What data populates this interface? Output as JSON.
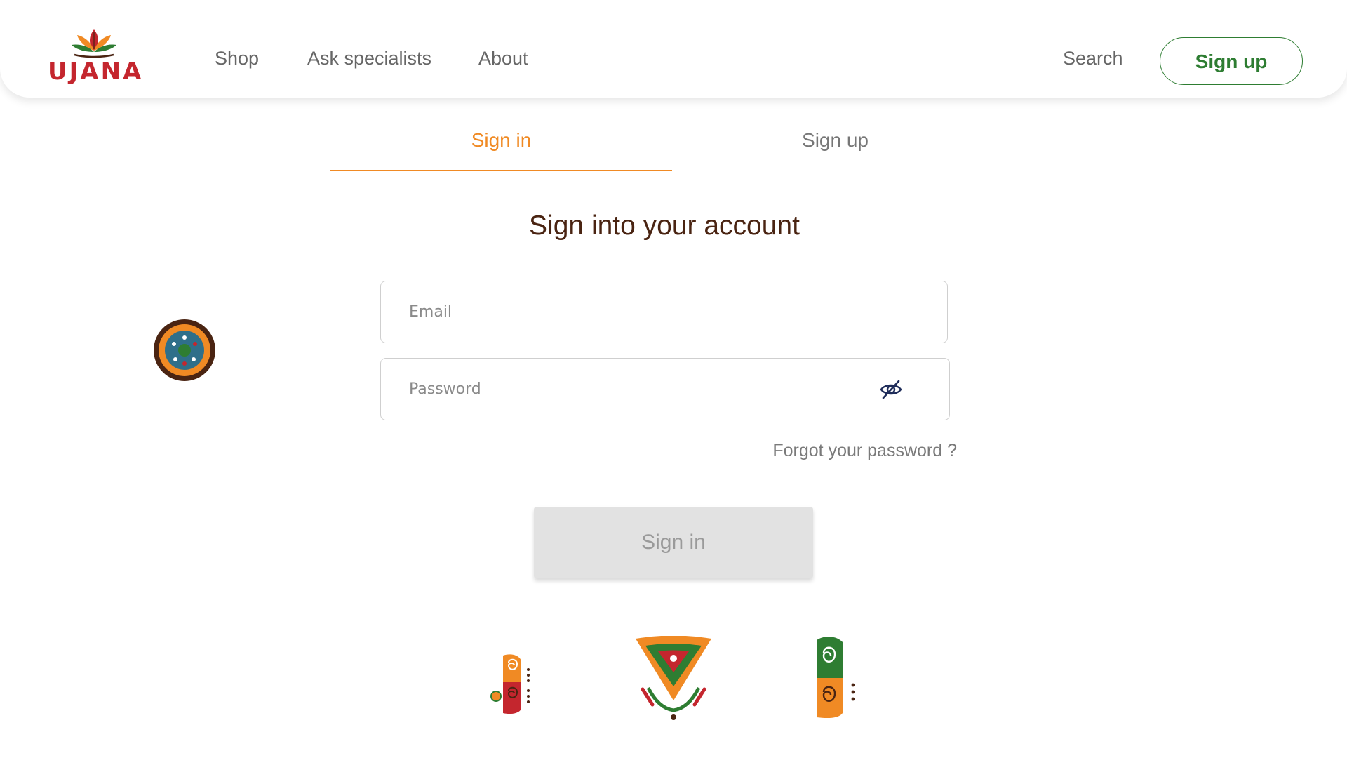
{
  "header": {
    "logo_text": "UJANA",
    "nav": {
      "shop": "Shop",
      "ask_specialists": "Ask specialists",
      "about": "About",
      "search": "Search"
    },
    "signup_button": "Sign up"
  },
  "tabs": {
    "sign_in": "Sign in",
    "sign_up": "Sign up",
    "active": "sign_in"
  },
  "form": {
    "title": "Sign into your account",
    "email": {
      "placeholder": "Email",
      "value": ""
    },
    "password": {
      "placeholder": "Password",
      "value": ""
    },
    "forgot_link": "Forgot your password ?",
    "submit_label": "Sign in"
  },
  "icons": {
    "password_toggle": "eye-slash-icon",
    "logo_mark": "lotus-leaf-icon"
  },
  "colors": {
    "accent_orange": "#f08a24",
    "brand_green": "#2e7d32",
    "brand_red": "#c4262e",
    "title_brown": "#4a2412",
    "button_disabled_bg": "#e2e2e2"
  }
}
